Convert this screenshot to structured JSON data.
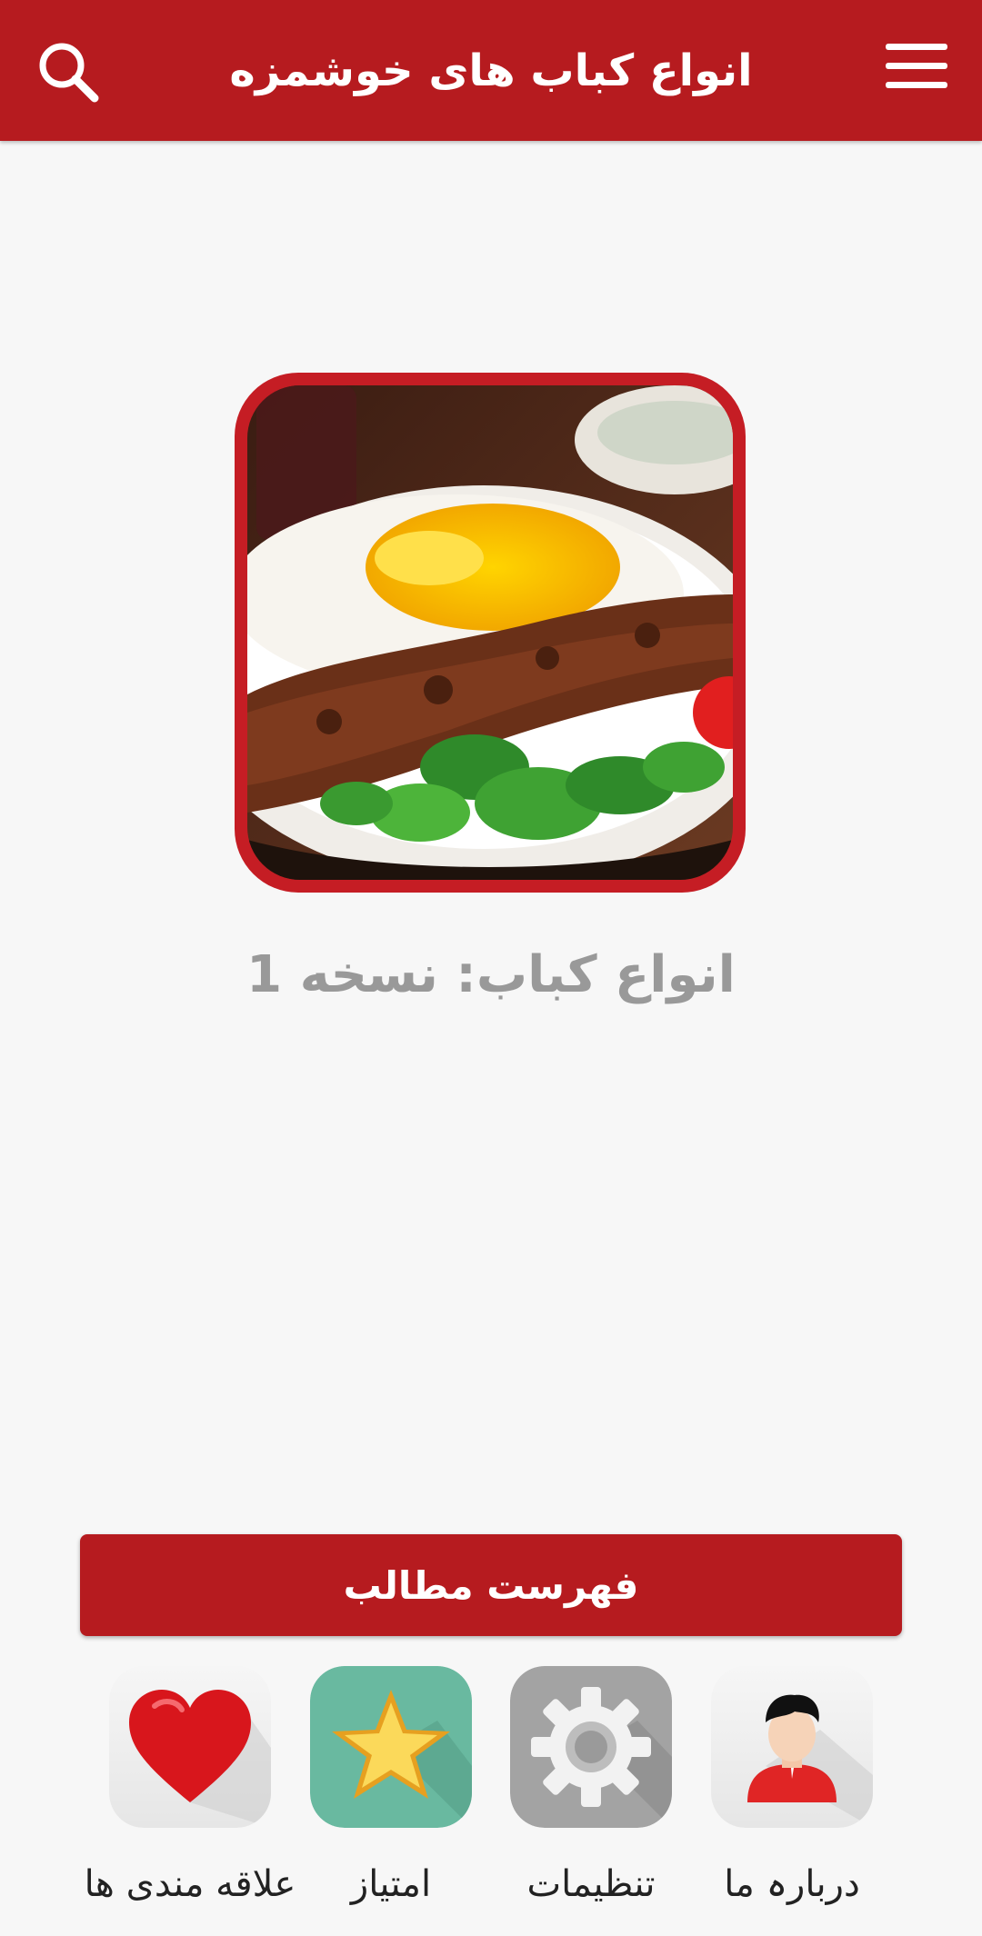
{
  "appbar": {
    "title": "انواع کباب های خوشمزه",
    "search_icon": "search-icon",
    "menu_icon": "hamburger-menu-icon",
    "color": "#b61b1f"
  },
  "hero": {
    "image": "kebab-plate-image",
    "frame_color": "#c51d24"
  },
  "version_text": "انواع کباب: نسخه 1",
  "toc_button": {
    "label": "فهرست مطالب"
  },
  "tiles": [
    {
      "label": "دربارہ ما",
      "icon": "user-icon"
    },
    {
      "label": "تنظیمات",
      "icon": "gear-icon"
    },
    {
      "label": "امتیاز",
      "icon": "star-icon"
    },
    {
      "label": "علاقه مندی ها",
      "icon": "heart-icon"
    }
  ]
}
